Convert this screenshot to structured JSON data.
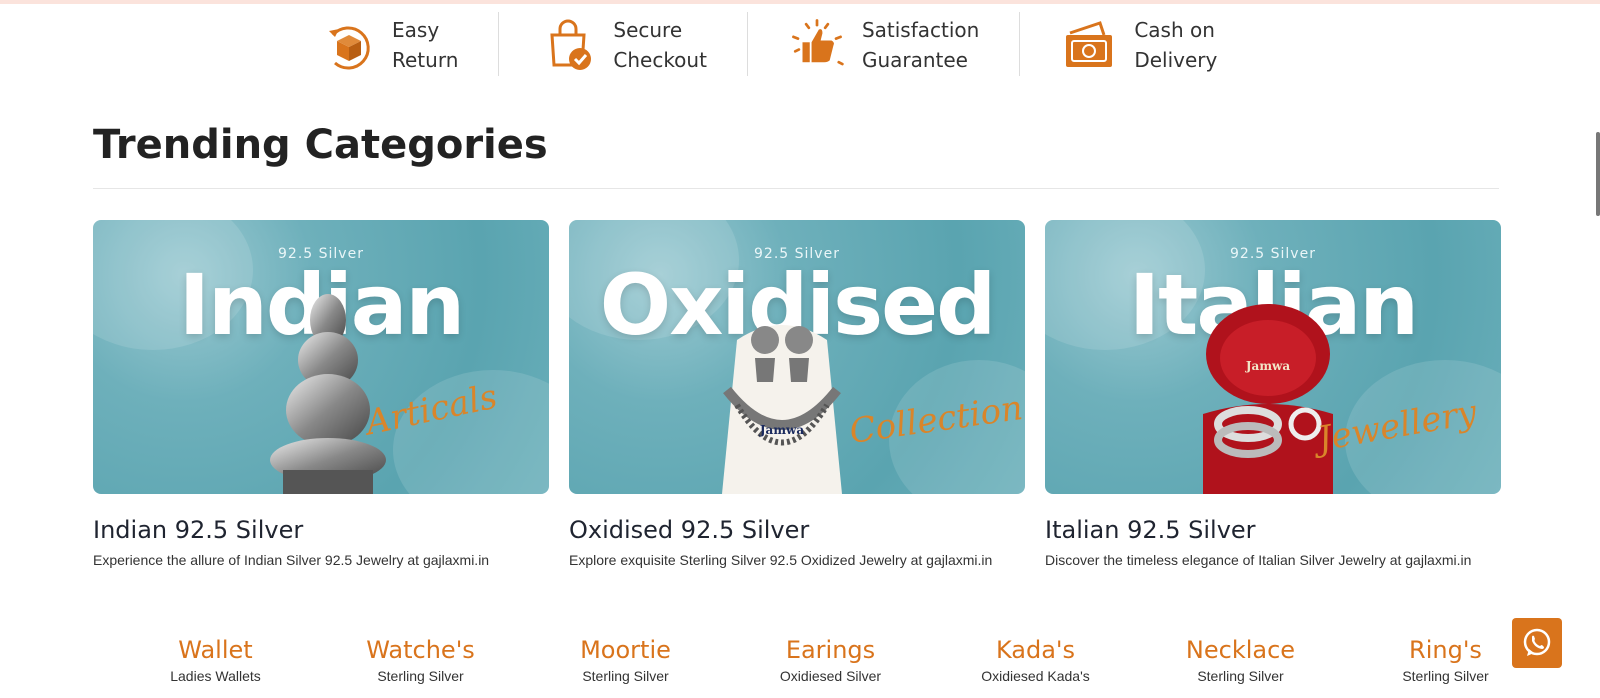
{
  "features": [
    {
      "line1": "Easy",
      "line2": "Return",
      "icon": "return-box-icon"
    },
    {
      "line1": "Secure",
      "line2": "Checkout",
      "icon": "secure-bag-icon"
    },
    {
      "line1": "Satisfaction",
      "line2": "Guarantee",
      "icon": "thumbs-up-icon"
    },
    {
      "line1": "Cash on",
      "line2": "Delivery",
      "icon": "cash-icon"
    }
  ],
  "section": {
    "title": "Trending Categories"
  },
  "cards": [
    {
      "small": "92.5 Silver",
      "big": "Indian",
      "script": "Articals",
      "title": "Indian 92.5 Silver",
      "desc": "Experience the allure of Indian Silver 92.5 Jewelry at gajlaxmi.in"
    },
    {
      "small": "92.5 Silver",
      "big": "Oxidised",
      "script": "Collection",
      "title": "Oxidised 92.5 Silver",
      "desc": "Explore exquisite Sterling Silver 92.5 Oxidized Jewelry at gajlaxmi.in"
    },
    {
      "small": "92.5 Silver",
      "big": "Italian",
      "script": "Jewellery",
      "title": "Italian 92.5 Silver",
      "desc": "Discover the timeless elegance of Italian Silver Jewelry at gajlaxmi.in"
    }
  ],
  "brand": "Jamwa",
  "categories": [
    {
      "name": "Wallet",
      "sub": "Ladies Wallets"
    },
    {
      "name": "Watche's",
      "sub": "Sterling Silver"
    },
    {
      "name": "Moortie",
      "sub": "Sterling Silver"
    },
    {
      "name": "Earings",
      "sub": "Oxidiesed Silver"
    },
    {
      "name": "Kada's",
      "sub": "Oxidiesed Kada's"
    },
    {
      "name": "Necklace",
      "sub": "Sterling Silver"
    },
    {
      "name": "Ring's",
      "sub": "Sterling Silver"
    }
  ],
  "colors": {
    "accent": "#d9741c",
    "banner": "#6eb0bb"
  }
}
